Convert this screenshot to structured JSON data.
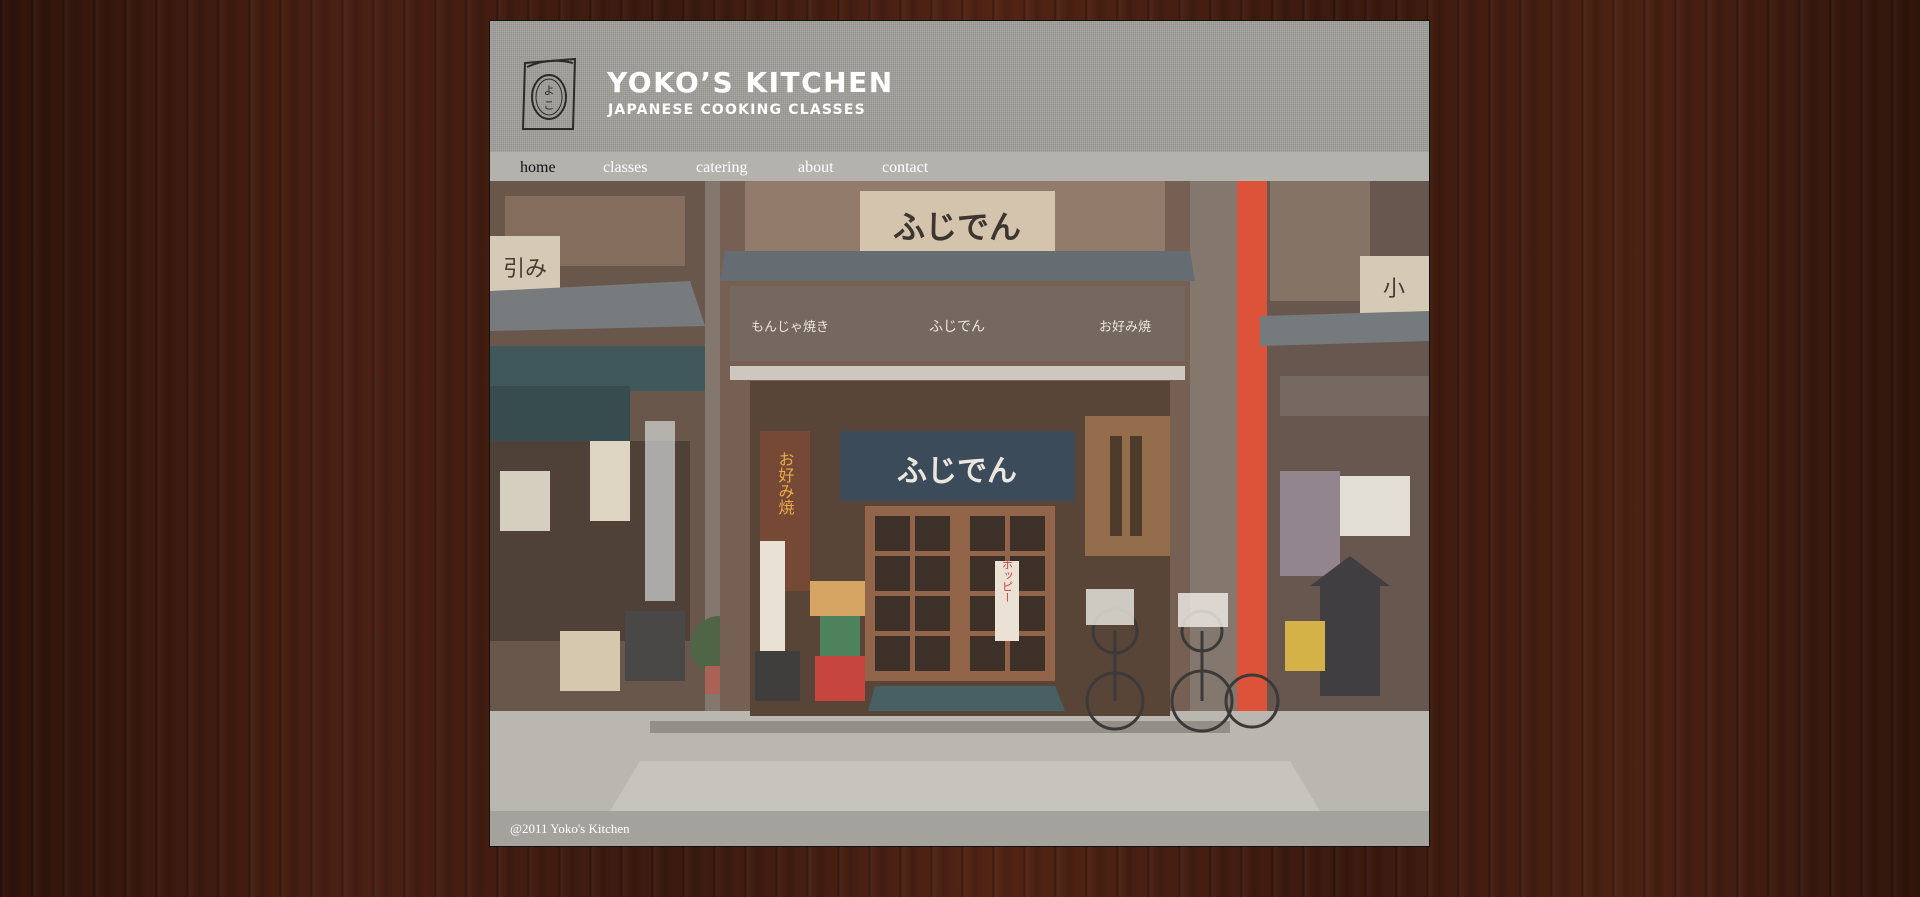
{
  "brand": {
    "title": "YOKO’S KITCHEN",
    "subtitle": "JAPANESE COOKING CLASSES",
    "logo_text": "よこ"
  },
  "nav": {
    "items": [
      {
        "label": "home",
        "active": true
      },
      {
        "label": "classes",
        "active": false
      },
      {
        "label": "catering",
        "active": false
      },
      {
        "label": "about",
        "active": false
      },
      {
        "label": "contact",
        "active": false
      }
    ]
  },
  "hero": {
    "signs": {
      "roof_sign": "ふじでん",
      "noren": "ふじでん",
      "left_roof_sign": "引み",
      "right_roof_sign": "小",
      "awning_left": "もんじゃ焼き",
      "awning_center": "ふじでん",
      "awning_right": "お好み焼",
      "vertical_sign": "お好み焼",
      "red_sign": "ホッピー"
    }
  },
  "footer": {
    "text": "@2011 Yoko's Kitchen"
  },
  "colors": {
    "wood_background": "#3a1a10",
    "header_bg": "#a09e99",
    "nav_bg": "#b3b2ad",
    "footer_bg": "#a3a29d",
    "text_light": "#ffffff",
    "nav_active": "#111111"
  }
}
